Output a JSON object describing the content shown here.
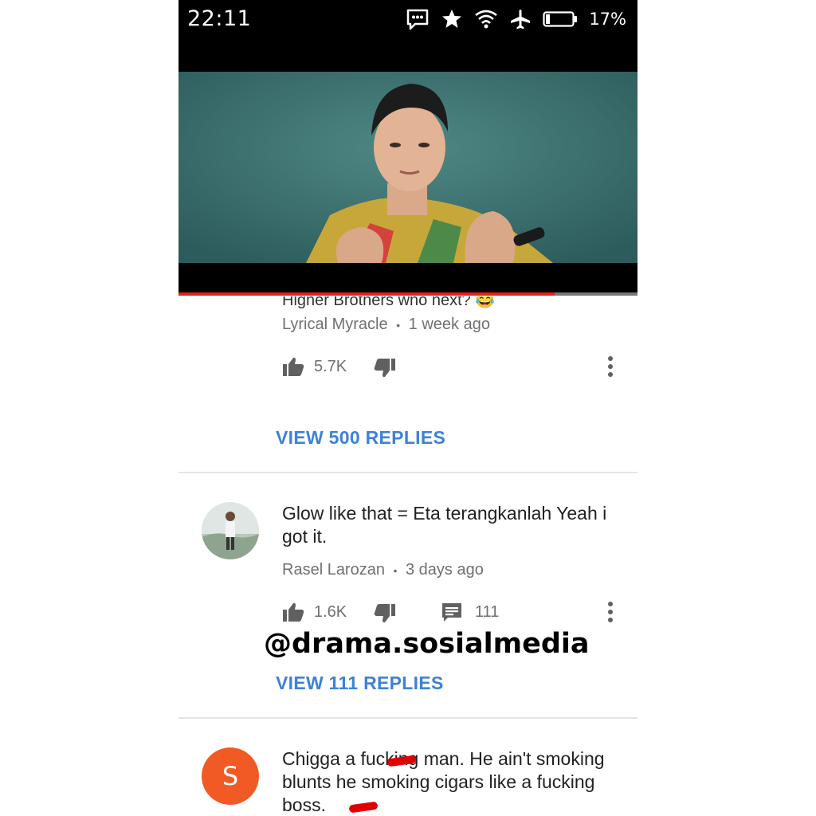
{
  "status_bar": {
    "time": "22:11",
    "battery": "17%",
    "icons": [
      "message-icon",
      "star-icon",
      "wifi-icon",
      "airplane-icon",
      "battery-icon"
    ]
  },
  "video": {
    "progress_fraction": 0.82
  },
  "comments": [
    {
      "text_cutoff": "Higher Brothers who next? 😂",
      "author": "Lyrical Myracle",
      "time": "1 week ago",
      "likes": "5.7K",
      "view_replies": "VIEW 500 REPLIES"
    },
    {
      "text": "Glow like that = Eta terangkanlah Yeah i got it.",
      "author": "Rasel Larozan",
      "time": "3 days ago",
      "likes": "1.6K",
      "reply_count": "111",
      "view_replies": "VIEW 111 REPLIES"
    },
    {
      "avatar_letter": "S",
      "text": "Chigga a fucking man. He ain't smoking blunts he smoking cigars like a fucking boss."
    }
  ],
  "separator": "•",
  "watermark": "@drama.sosialmedia",
  "colors": {
    "accent_blue": "#3e82d6",
    "progress_red": "#e62117",
    "avatar_orange": "#f15a24",
    "meta_gray": "#707070"
  }
}
